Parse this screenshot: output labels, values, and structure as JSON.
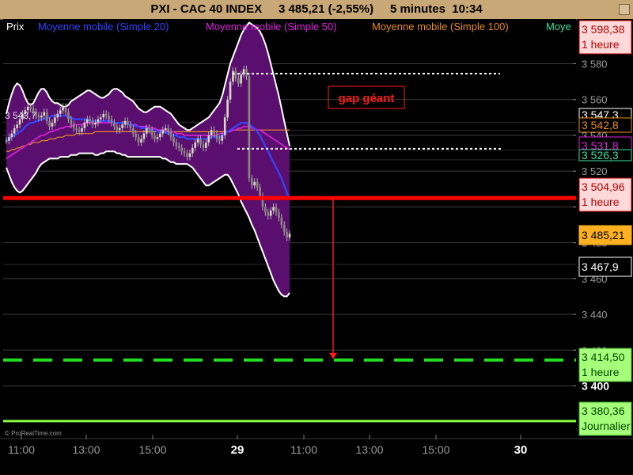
{
  "title": "PXI - CAC 40 INDEX     3 485,21 (-2,55%)     5 minutes  10:34",
  "legend": {
    "items": [
      {
        "label": "Prix",
        "color": "#ffffff"
      },
      {
        "label": "Moyenne mobile (Simple 20)",
        "color": "#3344ff"
      },
      {
        "label": "Moyenne mobile (Simple 50)",
        "color": "#e020e0"
      },
      {
        "label": "Moyenne mobile (Simple 100)",
        "color": "#e88a20"
      },
      {
        "label": "Moye",
        "color": "#40e0a0"
      }
    ]
  },
  "annotation": {
    "text": "gap géant",
    "color": "#ff1a1a"
  },
  "start_label": "3 543,7",
  "watermark": "© ProRealTime.com",
  "colors": {
    "background": "#000000",
    "title_bar": "#c9a878",
    "bollinger_fill": "#5a0f6e",
    "resistance": "#ff0000",
    "target": "#22dd22",
    "daily": "#88ff44"
  },
  "chart_data": {
    "type": "candlestick",
    "interval": "5 minutes",
    "ylim": [
      3375,
      3605
    ],
    "y_ticks": [
      "3 580",
      "3 560",
      "3 540",
      "3 520",
      "3 500",
      "3 480",
      "3 460",
      "3 440",
      "3 420",
      "3 400"
    ],
    "y_tick_values": [
      3580,
      3560,
      3540,
      3520,
      3500,
      3480,
      3460,
      3440,
      3420,
      3400
    ],
    "x_ticks": [
      "11:00",
      "13:00",
      "15:00",
      "29",
      "11:00",
      "13:00",
      "15:00",
      "30"
    ],
    "price_tags": [
      {
        "label": "3 598,38",
        "price": 3598.38,
        "period": "1 heure",
        "kind": "light"
      },
      {
        "label": "3 547,3",
        "price": 3547.3,
        "kind": "partial-white"
      },
      {
        "label": "3 542,8",
        "price": 3542.8,
        "kind": "orange"
      },
      {
        "label": "3 531,8",
        "price": 3531.8,
        "kind": "magenta"
      },
      {
        "label": "3 526,3",
        "price": 3526.3,
        "kind": "partial-green"
      },
      {
        "label": "3 504,96",
        "price": 3504.96,
        "period": "1 heure",
        "kind": "light"
      },
      {
        "label": "3 485,21",
        "price": 3485.21,
        "kind": "current"
      },
      {
        "label": "3 467,9",
        "price": 3467.9,
        "kind": "white"
      },
      {
        "label": "3 414,50",
        "price": 3414.5,
        "period": "1 heure",
        "kind": "green"
      },
      {
        "label": "3 400",
        "price": 3400,
        "kind": "round"
      },
      {
        "label": "3 380,36",
        "price": 3380.36,
        "period": "Journalier",
        "kind": "green"
      }
    ],
    "levels": {
      "resistance": 3504.96,
      "target": 3414.5,
      "daily": 3380.36
    },
    "gap": {
      "upper": 3574.5,
      "lower": 3532.5
    },
    "series": [
      {
        "name": "Prix",
        "values": [
          3537,
          3539,
          3541,
          3544,
          3546,
          3549,
          3552,
          3554,
          3556,
          3555,
          3553,
          3551,
          3550,
          3551,
          3553,
          3548,
          3545,
          3547,
          3550,
          3552,
          3554,
          3556,
          3553,
          3549,
          3546,
          3544,
          3543,
          3542,
          3544,
          3547,
          3549,
          3548,
          3546,
          3547,
          3549,
          3550,
          3552,
          3551,
          3549,
          3547,
          3545,
          3543,
          3544,
          3546,
          3548,
          3546,
          3544,
          3541,
          3539,
          3536,
          3538,
          3541,
          3544,
          3543,
          3540,
          3538,
          3539,
          3541,
          3543,
          3544,
          3542,
          3539,
          3536,
          3534,
          3533,
          3531,
          3530,
          3528,
          3530,
          3533,
          3536,
          3538,
          3535,
          3533,
          3536,
          3540,
          3543,
          3541,
          3538,
          3537,
          3540,
          3550,
          3560,
          3570,
          3576,
          3572,
          3569,
          3574,
          3577,
          3573,
          3516,
          3512,
          3514,
          3511,
          3506,
          3500,
          3497,
          3495,
          3498,
          3500,
          3497,
          3494,
          3490,
          3486,
          3483,
          3485
        ]
      },
      {
        "name": "Moyenne mobile (Simple 20)",
        "values": [
          3537,
          3538,
          3539,
          3540,
          3541,
          3542,
          3543,
          3545,
          3546,
          3547,
          3547,
          3548,
          3548,
          3549,
          3549,
          3550,
          3550,
          3551,
          3551,
          3551,
          3551,
          3551,
          3551,
          3550,
          3550,
          3549,
          3549,
          3549,
          3549,
          3549,
          3549,
          3548,
          3548,
          3548,
          3548,
          3548,
          3548,
          3548,
          3548,
          3548,
          3547,
          3547,
          3547,
          3547,
          3547,
          3546,
          3546,
          3546,
          3545,
          3545,
          3544,
          3544,
          3544,
          3543,
          3543,
          3543,
          3542,
          3542,
          3542,
          3542,
          3541,
          3541,
          3540,
          3540,
          3539,
          3539,
          3539,
          3538,
          3538,
          3538,
          3538,
          3538,
          3538,
          3538,
          3538,
          3538,
          3539,
          3539,
          3539,
          3539,
          3540,
          3541,
          3542,
          3543,
          3544,
          3545,
          3546,
          3547,
          3547,
          3547,
          3546,
          3545,
          3544,
          3542,
          3540,
          3537,
          3534,
          3531,
          3528,
          3525,
          3522,
          3519,
          3516,
          3512,
          3508,
          3504
        ]
      },
      {
        "name": "Moyenne mobile (Simple 50)",
        "values": [
          3527,
          3528,
          3529,
          3530,
          3531,
          3532,
          3533,
          3534,
          3535,
          3536,
          3537,
          3538,
          3539,
          3540,
          3540,
          3541,
          3542,
          3542,
          3543,
          3543,
          3544,
          3544,
          3545,
          3545,
          3545,
          3546,
          3546,
          3546,
          3546,
          3547,
          3547,
          3547,
          3547,
          3547,
          3547,
          3547,
          3547,
          3547,
          3547,
          3547,
          3547,
          3547,
          3547,
          3547,
          3547,
          3546,
          3546,
          3546,
          3546,
          3545,
          3545,
          3545,
          3545,
          3544,
          3544,
          3544,
          3543,
          3543,
          3543,
          3543,
          3542,
          3542,
          3542,
          3541,
          3541,
          3541,
          3540,
          3540,
          3540,
          3540,
          3540,
          3540,
          3540,
          3540,
          3540,
          3540,
          3540,
          3540,
          3540,
          3541,
          3541,
          3541,
          3542,
          3542,
          3543,
          3543,
          3544,
          3544,
          3545,
          3545,
          3545,
          3544,
          3544,
          3543,
          3543,
          3542,
          3541,
          3540,
          3539,
          3538,
          3537,
          3536,
          3535,
          3534,
          3533,
          3532
        ]
      },
      {
        "name": "Moyenne mobile (Simple 100)",
        "values": [
          3531,
          3531,
          3532,
          3532,
          3533,
          3533,
          3534,
          3534,
          3535,
          3535,
          3536,
          3536,
          3536,
          3537,
          3537,
          3537,
          3538,
          3538,
          3538,
          3539,
          3539,
          3539,
          3540,
          3540,
          3540,
          3540,
          3541,
          3541,
          3541,
          3541,
          3541,
          3541,
          3541,
          3542,
          3542,
          3542,
          3542,
          3542,
          3542,
          3542,
          3542,
          3542,
          3542,
          3542,
          3542,
          3542,
          3542,
          3542,
          3542,
          3542,
          3542,
          3542,
          3542,
          3542,
          3542,
          3542,
          3542,
          3542,
          3542,
          3542,
          3542,
          3542,
          3542,
          3542,
          3542,
          3542,
          3542,
          3542,
          3542,
          3542,
          3542,
          3542,
          3542,
          3542,
          3542,
          3542,
          3542,
          3542,
          3542,
          3542,
          3542,
          3542,
          3542,
          3542,
          3543,
          3543,
          3543,
          3543,
          3543,
          3543,
          3543,
          3543,
          3543,
          3543,
          3543,
          3543,
          3543,
          3543,
          3543,
          3543,
          3543,
          3543,
          3543,
          3543,
          3543,
          3543
        ]
      },
      {
        "name": "Bollinger upper",
        "values": [
          3552,
          3558,
          3563,
          3567,
          3569,
          3568,
          3565,
          3561,
          3558,
          3557,
          3558,
          3561,
          3564,
          3566,
          3566,
          3564,
          3561,
          3559,
          3558,
          3558,
          3557,
          3556,
          3556,
          3557,
          3559,
          3560,
          3561,
          3562,
          3563,
          3564,
          3565,
          3565,
          3564,
          3563,
          3562,
          3561,
          3561,
          3562,
          3563,
          3565,
          3566,
          3566,
          3565,
          3564,
          3562,
          3561,
          3560,
          3559,
          3557,
          3555,
          3554,
          3553,
          3553,
          3554,
          3555,
          3556,
          3556,
          3556,
          3555,
          3554,
          3553,
          3552,
          3550,
          3548,
          3546,
          3545,
          3544,
          3543,
          3543,
          3544,
          3545,
          3546,
          3547,
          3548,
          3549,
          3550,
          3552,
          3554,
          3556,
          3558,
          3562,
          3568,
          3574,
          3580,
          3584,
          3588,
          3592,
          3596,
          3599,
          3601,
          3603,
          3602,
          3601,
          3600,
          3598,
          3595,
          3591,
          3586,
          3580,
          3574,
          3568,
          3562,
          3555,
          3548,
          3541,
          3534
        ]
      },
      {
        "name": "Bollinger lower",
        "values": [
          3522,
          3518,
          3514,
          3511,
          3509,
          3508,
          3509,
          3511,
          3513,
          3515,
          3517,
          3519,
          3522,
          3524,
          3525,
          3526,
          3527,
          3527,
          3527,
          3527,
          3528,
          3528,
          3528,
          3528,
          3529,
          3529,
          3529,
          3530,
          3530,
          3530,
          3530,
          3530,
          3530,
          3529,
          3529,
          3530,
          3530,
          3531,
          3531,
          3531,
          3531,
          3530,
          3530,
          3529,
          3529,
          3528,
          3528,
          3528,
          3528,
          3528,
          3528,
          3528,
          3528,
          3528,
          3528,
          3528,
          3528,
          3528,
          3527,
          3527,
          3526,
          3525,
          3525,
          3524,
          3524,
          3524,
          3524,
          3524,
          3523,
          3522,
          3520,
          3518,
          3516,
          3514,
          3512,
          3512,
          3513,
          3514,
          3515,
          3516,
          3517,
          3518,
          3518,
          3516,
          3513,
          3510,
          3507,
          3503,
          3500,
          3497,
          3494,
          3490,
          3487,
          3483,
          3479,
          3475,
          3471,
          3467,
          3463,
          3459,
          3456,
          3453,
          3451,
          3450,
          3450,
          3452
        ]
      }
    ]
  }
}
